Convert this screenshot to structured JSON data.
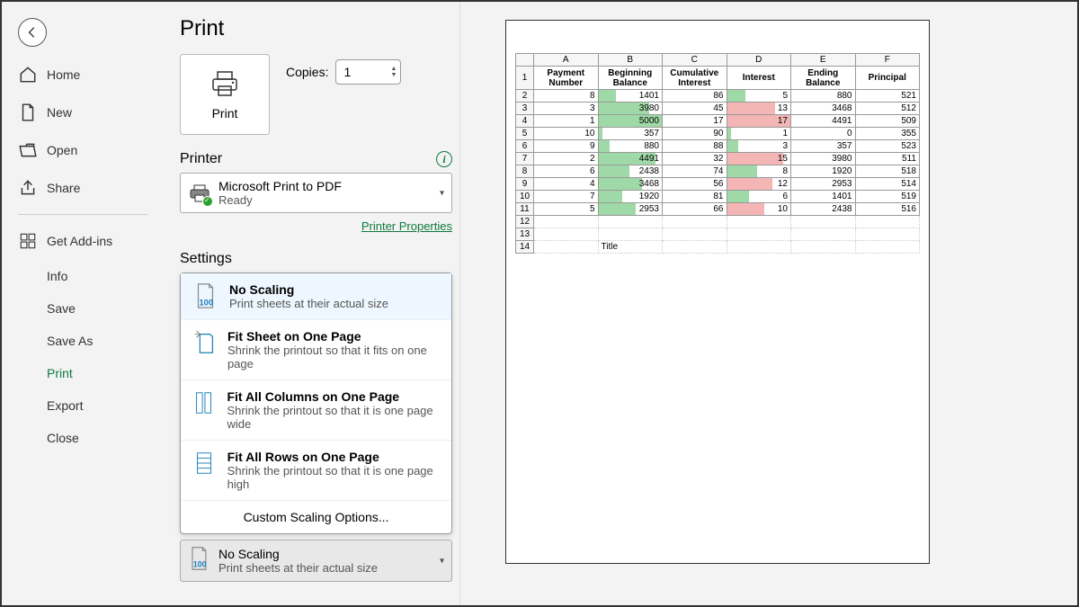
{
  "page_title": "Print",
  "back_aria": "Back",
  "nav": {
    "home": "Home",
    "new": "New",
    "open": "Open",
    "share": "Share",
    "addins": "Get Add-ins",
    "info": "Info",
    "save": "Save",
    "save_as": "Save As",
    "print": "Print",
    "export": "Export",
    "close": "Close"
  },
  "print_button": "Print",
  "copies_label": "Copies:",
  "copies_value": "1",
  "printer_section": "Printer",
  "printer": {
    "name": "Microsoft Print to PDF",
    "status": "Ready"
  },
  "printer_properties": "Printer Properties",
  "settings_section": "Settings",
  "scaling_options": [
    {
      "title": "No Scaling",
      "desc": "Print sheets at their actual size"
    },
    {
      "title": "Fit Sheet on One Page",
      "desc": "Shrink the printout so that it fits on one page"
    },
    {
      "title": "Fit All Columns on One Page",
      "desc": "Shrink the printout so that it is one page wide"
    },
    {
      "title": "Fit All Rows on One Page",
      "desc": "Shrink the printout so that it is one page high"
    }
  ],
  "custom_scaling": "Custom Scaling Options...",
  "selected_scaling": {
    "title": "No Scaling",
    "desc": "Print sheets at their actual size"
  },
  "preview": {
    "col_letters": [
      "A",
      "B",
      "C",
      "D",
      "E",
      "F"
    ],
    "headers": [
      "Payment Number",
      "Beginning Balance",
      "Cumulative Interest",
      "Interest",
      "Ending Balance",
      "Principal"
    ],
    "rows": [
      {
        "r": 2,
        "a": 8,
        "b": 1401,
        "c": 86,
        "d": 5,
        "e": 880,
        "f": 521
      },
      {
        "r": 3,
        "a": 3,
        "b": 3980,
        "c": 45,
        "d": 13,
        "e": 3468,
        "f": 512
      },
      {
        "r": 4,
        "a": 1,
        "b": 5000,
        "c": 17,
        "d": 17,
        "e": 4491,
        "f": 509
      },
      {
        "r": 5,
        "a": 10,
        "b": 357,
        "c": 90,
        "d": 1,
        "e": 0,
        "f": 355
      },
      {
        "r": 6,
        "a": 9,
        "b": 880,
        "c": 88,
        "d": 3,
        "e": 357,
        "f": 523
      },
      {
        "r": 7,
        "a": 2,
        "b": 4491,
        "c": 32,
        "d": 15,
        "e": 3980,
        "f": 511
      },
      {
        "r": 8,
        "a": 6,
        "b": 2438,
        "c": 74,
        "d": 8,
        "e": 1920,
        "f": 518
      },
      {
        "r": 9,
        "a": 4,
        "b": 3468,
        "c": 56,
        "d": 12,
        "e": 2953,
        "f": 514
      },
      {
        "r": 10,
        "a": 7,
        "b": 1920,
        "c": 81,
        "d": 6,
        "e": 1401,
        "f": 519
      },
      {
        "r": 11,
        "a": 5,
        "b": 2953,
        "c": 66,
        "d": 10,
        "e": 2438,
        "f": 516
      }
    ],
    "empty_rows": [
      12,
      13
    ],
    "title_row": {
      "r": 14,
      "b": "Title"
    },
    "b_max": 5000,
    "d_max": 17,
    "d_threshold": 10
  }
}
